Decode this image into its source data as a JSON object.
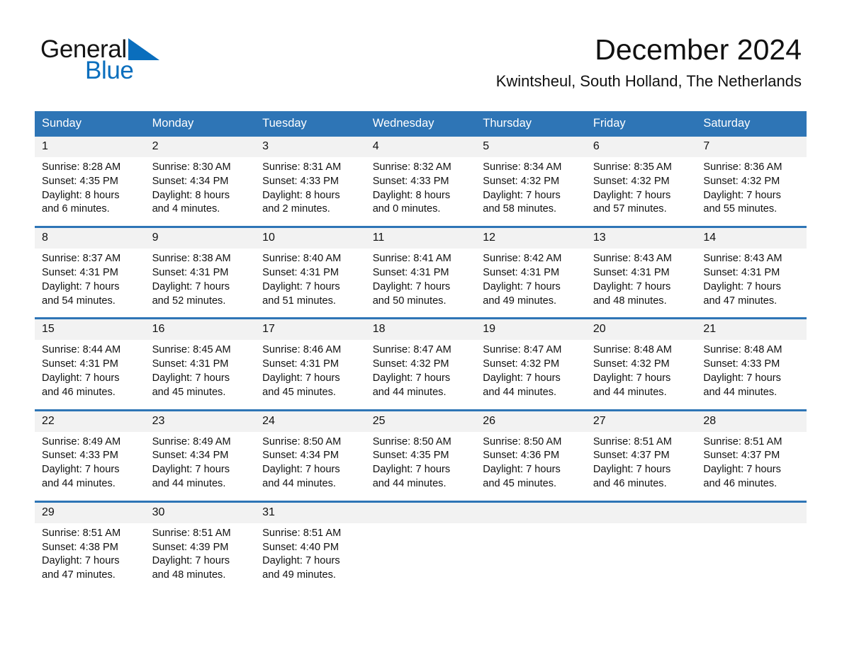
{
  "brand": {
    "name_part1": "General",
    "name_part2": "Blue",
    "accent_color": "#2e75b6",
    "logo_blue": "#0a6ebd"
  },
  "header": {
    "title": "December 2024",
    "location": "Kwintsheul, South Holland, The Netherlands"
  },
  "calendar": {
    "weekday_headers": [
      "Sunday",
      "Monday",
      "Tuesday",
      "Wednesday",
      "Thursday",
      "Friday",
      "Saturday"
    ],
    "weeks": [
      [
        {
          "day": "1",
          "sunrise": "Sunrise: 8:28 AM",
          "sunset": "Sunset: 4:35 PM",
          "daylight1": "Daylight: 8 hours",
          "daylight2": "and 6 minutes."
        },
        {
          "day": "2",
          "sunrise": "Sunrise: 8:30 AM",
          "sunset": "Sunset: 4:34 PM",
          "daylight1": "Daylight: 8 hours",
          "daylight2": "and 4 minutes."
        },
        {
          "day": "3",
          "sunrise": "Sunrise: 8:31 AM",
          "sunset": "Sunset: 4:33 PM",
          "daylight1": "Daylight: 8 hours",
          "daylight2": "and 2 minutes."
        },
        {
          "day": "4",
          "sunrise": "Sunrise: 8:32 AM",
          "sunset": "Sunset: 4:33 PM",
          "daylight1": "Daylight: 8 hours",
          "daylight2": "and 0 minutes."
        },
        {
          "day": "5",
          "sunrise": "Sunrise: 8:34 AM",
          "sunset": "Sunset: 4:32 PM",
          "daylight1": "Daylight: 7 hours",
          "daylight2": "and 58 minutes."
        },
        {
          "day": "6",
          "sunrise": "Sunrise: 8:35 AM",
          "sunset": "Sunset: 4:32 PM",
          "daylight1": "Daylight: 7 hours",
          "daylight2": "and 57 minutes."
        },
        {
          "day": "7",
          "sunrise": "Sunrise: 8:36 AM",
          "sunset": "Sunset: 4:32 PM",
          "daylight1": "Daylight: 7 hours",
          "daylight2": "and 55 minutes."
        }
      ],
      [
        {
          "day": "8",
          "sunrise": "Sunrise: 8:37 AM",
          "sunset": "Sunset: 4:31 PM",
          "daylight1": "Daylight: 7 hours",
          "daylight2": "and 54 minutes."
        },
        {
          "day": "9",
          "sunrise": "Sunrise: 8:38 AM",
          "sunset": "Sunset: 4:31 PM",
          "daylight1": "Daylight: 7 hours",
          "daylight2": "and 52 minutes."
        },
        {
          "day": "10",
          "sunrise": "Sunrise: 8:40 AM",
          "sunset": "Sunset: 4:31 PM",
          "daylight1": "Daylight: 7 hours",
          "daylight2": "and 51 minutes."
        },
        {
          "day": "11",
          "sunrise": "Sunrise: 8:41 AM",
          "sunset": "Sunset: 4:31 PM",
          "daylight1": "Daylight: 7 hours",
          "daylight2": "and 50 minutes."
        },
        {
          "day": "12",
          "sunrise": "Sunrise: 8:42 AM",
          "sunset": "Sunset: 4:31 PM",
          "daylight1": "Daylight: 7 hours",
          "daylight2": "and 49 minutes."
        },
        {
          "day": "13",
          "sunrise": "Sunrise: 8:43 AM",
          "sunset": "Sunset: 4:31 PM",
          "daylight1": "Daylight: 7 hours",
          "daylight2": "and 48 minutes."
        },
        {
          "day": "14",
          "sunrise": "Sunrise: 8:43 AM",
          "sunset": "Sunset: 4:31 PM",
          "daylight1": "Daylight: 7 hours",
          "daylight2": "and 47 minutes."
        }
      ],
      [
        {
          "day": "15",
          "sunrise": "Sunrise: 8:44 AM",
          "sunset": "Sunset: 4:31 PM",
          "daylight1": "Daylight: 7 hours",
          "daylight2": "and 46 minutes."
        },
        {
          "day": "16",
          "sunrise": "Sunrise: 8:45 AM",
          "sunset": "Sunset: 4:31 PM",
          "daylight1": "Daylight: 7 hours",
          "daylight2": "and 45 minutes."
        },
        {
          "day": "17",
          "sunrise": "Sunrise: 8:46 AM",
          "sunset": "Sunset: 4:31 PM",
          "daylight1": "Daylight: 7 hours",
          "daylight2": "and 45 minutes."
        },
        {
          "day": "18",
          "sunrise": "Sunrise: 8:47 AM",
          "sunset": "Sunset: 4:32 PM",
          "daylight1": "Daylight: 7 hours",
          "daylight2": "and 44 minutes."
        },
        {
          "day": "19",
          "sunrise": "Sunrise: 8:47 AM",
          "sunset": "Sunset: 4:32 PM",
          "daylight1": "Daylight: 7 hours",
          "daylight2": "and 44 minutes."
        },
        {
          "day": "20",
          "sunrise": "Sunrise: 8:48 AM",
          "sunset": "Sunset: 4:32 PM",
          "daylight1": "Daylight: 7 hours",
          "daylight2": "and 44 minutes."
        },
        {
          "day": "21",
          "sunrise": "Sunrise: 8:48 AM",
          "sunset": "Sunset: 4:33 PM",
          "daylight1": "Daylight: 7 hours",
          "daylight2": "and 44 minutes."
        }
      ],
      [
        {
          "day": "22",
          "sunrise": "Sunrise: 8:49 AM",
          "sunset": "Sunset: 4:33 PM",
          "daylight1": "Daylight: 7 hours",
          "daylight2": "and 44 minutes."
        },
        {
          "day": "23",
          "sunrise": "Sunrise: 8:49 AM",
          "sunset": "Sunset: 4:34 PM",
          "daylight1": "Daylight: 7 hours",
          "daylight2": "and 44 minutes."
        },
        {
          "day": "24",
          "sunrise": "Sunrise: 8:50 AM",
          "sunset": "Sunset: 4:34 PM",
          "daylight1": "Daylight: 7 hours",
          "daylight2": "and 44 minutes."
        },
        {
          "day": "25",
          "sunrise": "Sunrise: 8:50 AM",
          "sunset": "Sunset: 4:35 PM",
          "daylight1": "Daylight: 7 hours",
          "daylight2": "and 44 minutes."
        },
        {
          "day": "26",
          "sunrise": "Sunrise: 8:50 AM",
          "sunset": "Sunset: 4:36 PM",
          "daylight1": "Daylight: 7 hours",
          "daylight2": "and 45 minutes."
        },
        {
          "day": "27",
          "sunrise": "Sunrise: 8:51 AM",
          "sunset": "Sunset: 4:37 PM",
          "daylight1": "Daylight: 7 hours",
          "daylight2": "and 46 minutes."
        },
        {
          "day": "28",
          "sunrise": "Sunrise: 8:51 AM",
          "sunset": "Sunset: 4:37 PM",
          "daylight1": "Daylight: 7 hours",
          "daylight2": "and 46 minutes."
        }
      ],
      [
        {
          "day": "29",
          "sunrise": "Sunrise: 8:51 AM",
          "sunset": "Sunset: 4:38 PM",
          "daylight1": "Daylight: 7 hours",
          "daylight2": "and 47 minutes."
        },
        {
          "day": "30",
          "sunrise": "Sunrise: 8:51 AM",
          "sunset": "Sunset: 4:39 PM",
          "daylight1": "Daylight: 7 hours",
          "daylight2": "and 48 minutes."
        },
        {
          "day": "31",
          "sunrise": "Sunrise: 8:51 AM",
          "sunset": "Sunset: 4:40 PM",
          "daylight1": "Daylight: 7 hours",
          "daylight2": "and 49 minutes."
        },
        {
          "day": "",
          "sunrise": "",
          "sunset": "",
          "daylight1": "",
          "daylight2": ""
        },
        {
          "day": "",
          "sunrise": "",
          "sunset": "",
          "daylight1": "",
          "daylight2": ""
        },
        {
          "day": "",
          "sunrise": "",
          "sunset": "",
          "daylight1": "",
          "daylight2": ""
        },
        {
          "day": "",
          "sunrise": "",
          "sunset": "",
          "daylight1": "",
          "daylight2": ""
        }
      ]
    ]
  }
}
